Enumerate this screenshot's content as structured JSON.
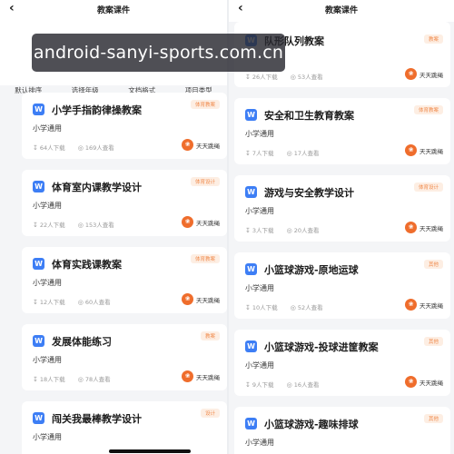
{
  "left_panel": {
    "back_icon": "chevron-left-icon",
    "title": "教案课件",
    "filters": [
      "默认排序",
      "选择年级",
      "文档格式",
      "项目类型"
    ],
    "cards": [
      {
        "title": "小学手指韵律操教案",
        "tag": "体育教案",
        "subtitle": "小学通用",
        "downloads": "64人下载",
        "views": "169人查看",
        "author": "天天跳绳"
      },
      {
        "title": "体育室内课教学设计",
        "tag": "体育设计",
        "subtitle": "小学通用",
        "downloads": "22人下载",
        "views": "153人查看",
        "author": "天天跳绳"
      },
      {
        "title": "体育实践课教案",
        "tag": "体育教案",
        "subtitle": "小学通用",
        "downloads": "12人下载",
        "views": "60人查看",
        "author": "天天跳绳"
      },
      {
        "title": "发展体能练习",
        "tag": "教案",
        "subtitle": "小学通用",
        "downloads": "18人下载",
        "views": "78人查看",
        "author": "天天跳绳"
      },
      {
        "title": "闯关我最棒教学设计",
        "tag": "设计",
        "subtitle": "小学通用",
        "downloads": "",
        "views": "",
        "author": ""
      }
    ]
  },
  "right_panel": {
    "back_icon": "chevron-left-icon",
    "title": "教案课件",
    "cards": [
      {
        "title": "队形队列教案",
        "tag": "教案",
        "subtitle": "",
        "downloads": "26人下载",
        "views": "53人查看",
        "author": "天天跳绳"
      },
      {
        "title": "安全和卫生教育教案",
        "tag": "体育教案",
        "subtitle": "小学通用",
        "downloads": "7人下载",
        "views": "17人查看",
        "author": "天天跳绳"
      },
      {
        "title": "游戏与安全教学设计",
        "tag": "体育设计",
        "subtitle": "小学通用",
        "downloads": "3人下载",
        "views": "20人查看",
        "author": "天天跳绳"
      },
      {
        "title": "小篮球游戏-原地运球",
        "tag": "其他",
        "subtitle": "小学通用",
        "downloads": "10人下载",
        "views": "52人查看",
        "author": "天天跳绳"
      },
      {
        "title": "小篮球游戏-投球进筐教案",
        "tag": "其他",
        "subtitle": "小学通用",
        "downloads": "9人下载",
        "views": "16人查看",
        "author": "天天跳绳"
      },
      {
        "title": "小篮球游戏-趣味排球",
        "tag": "其他",
        "subtitle": "小学通用",
        "downloads": "",
        "views": "",
        "author": ""
      }
    ]
  },
  "watermark": "android-sanyi-sports.com.cn",
  "colors": {
    "accent": "#3d7ef5",
    "tag": "#f08a4b",
    "logo": "#ef6d2c"
  }
}
